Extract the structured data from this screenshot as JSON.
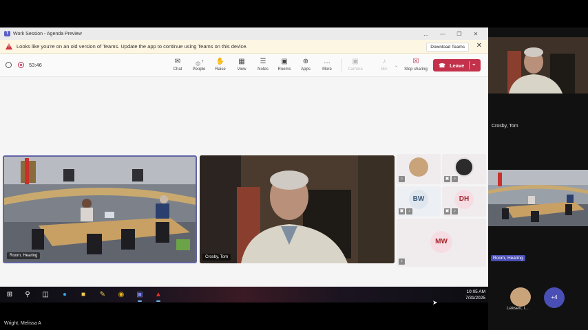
{
  "window": {
    "title": "Work Session - Agenda Preview",
    "controls": [
      "…",
      "—",
      "❐",
      "✕"
    ]
  },
  "banner": {
    "message": "Looks like you're on an old version of Teams. Update the app to continue using Teams on this device.",
    "download_label": "Download Teams",
    "close": "✕"
  },
  "meeting": {
    "timer": "53:46",
    "toolbar": [
      {
        "label": "Chat",
        "icon": "chat-icon",
        "glyph": "✉"
      },
      {
        "label": "People",
        "icon": "people-icon",
        "glyph": "☺",
        "badge": "7"
      },
      {
        "label": "Raise",
        "icon": "raise-hand-icon",
        "glyph": "✋"
      },
      {
        "label": "View",
        "icon": "view-grid-icon",
        "glyph": "▦"
      },
      {
        "label": "Notes",
        "icon": "notes-icon",
        "glyph": "☰"
      },
      {
        "label": "Rooms",
        "icon": "rooms-icon",
        "glyph": "▣"
      },
      {
        "label": "Apps",
        "icon": "apps-icon",
        "glyph": "⊕"
      },
      {
        "label": "More",
        "icon": "more-icon",
        "glyph": "…"
      }
    ],
    "camera_label": "Camera",
    "mic_label": "Mic",
    "stop_sharing_label": "Stop sharing",
    "leave_label": "Leave"
  },
  "stage": {
    "video_tiles": [
      {
        "name": "Room, Hearing"
      },
      {
        "name": "Crosby, Tom"
      }
    ],
    "participants": [
      {
        "initials": "",
        "type": "photo",
        "bg": "#c9a37a"
      },
      {
        "initials": "",
        "type": "photo",
        "bg": "#2b2b2b"
      },
      {
        "initials": "BW",
        "type": "initials",
        "bg": "#dfe6ee",
        "fg": "#3a5a7a"
      },
      {
        "initials": "DH",
        "type": "initials",
        "bg": "#f6dde3",
        "fg": "#a4262c"
      },
      {
        "initials": "MW",
        "type": "initials",
        "bg": "#f6dde3",
        "fg": "#a4262c"
      }
    ]
  },
  "taskbar": {
    "time": "10:05 AM",
    "date": "7/31/2025"
  },
  "side_panel": {
    "tom_label": "Crosby, Tom",
    "room_label": "Room, Hearing",
    "more_count": "+4",
    "self_name": "Lekseri, I...",
    "bottom_name": "Wright, Melissa A"
  },
  "colors": {
    "accent": "#5b5fc7",
    "leave": "#c4314b",
    "warning": "#d13438",
    "more_badge": "#4a4fb5"
  }
}
